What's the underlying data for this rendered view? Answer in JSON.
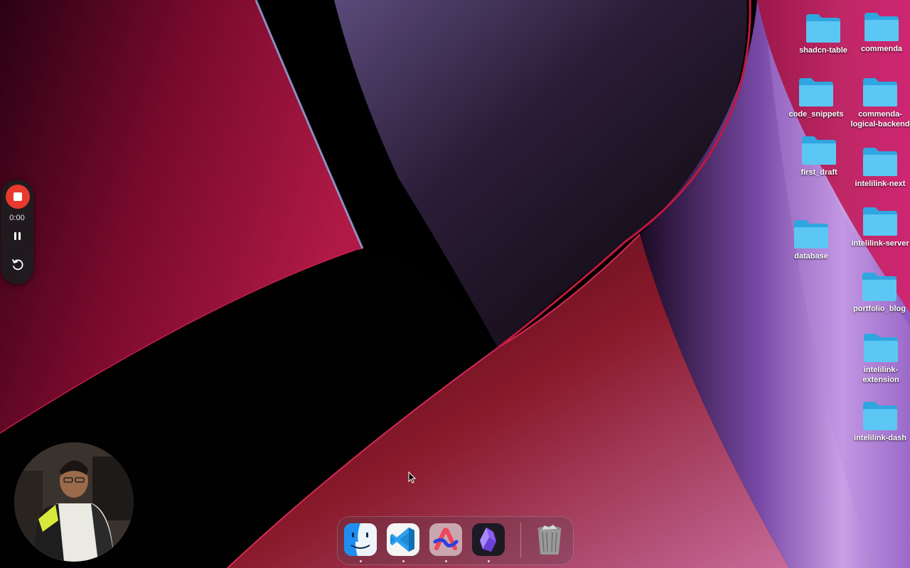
{
  "recorder": {
    "time": "0:00",
    "stop_icon": "stop-icon",
    "pause_icon": "pause-icon",
    "restart_icon": "restart-icon",
    "accent": "#e8392f"
  },
  "desktop": {
    "icons": [
      {
        "label": "shadcn-table",
        "icon": "folder-icon"
      },
      {
        "label": "commenda",
        "icon": "folder-icon"
      },
      {
        "label": "code_snippets",
        "icon": "folder-icon"
      },
      {
        "label": "commenda-\nlogical-backend",
        "icon": "folder-icon"
      },
      {
        "label": "first_draft",
        "icon": "folder-icon"
      },
      {
        "label": "intelilink-next",
        "icon": "folder-icon"
      },
      {
        "label": "database",
        "icon": "folder-icon"
      },
      {
        "label": "intelilink-server",
        "icon": "folder-icon"
      },
      {
        "label": "portfolio_blog",
        "icon": "folder-icon"
      },
      {
        "label": "intelilink-\nextension",
        "icon": "folder-icon"
      },
      {
        "label": "intelilink-dash",
        "icon": "folder-icon"
      }
    ],
    "folder_color": "#3fb8ee"
  },
  "dock": {
    "apps": [
      {
        "icon": "finder-icon",
        "running": true
      },
      {
        "icon": "vscode-icon",
        "running": true
      },
      {
        "icon": "arc-browser-icon",
        "running": true
      },
      {
        "icon": "obsidian-icon",
        "running": true
      },
      {
        "icon": "trash-icon",
        "running": false
      }
    ]
  }
}
